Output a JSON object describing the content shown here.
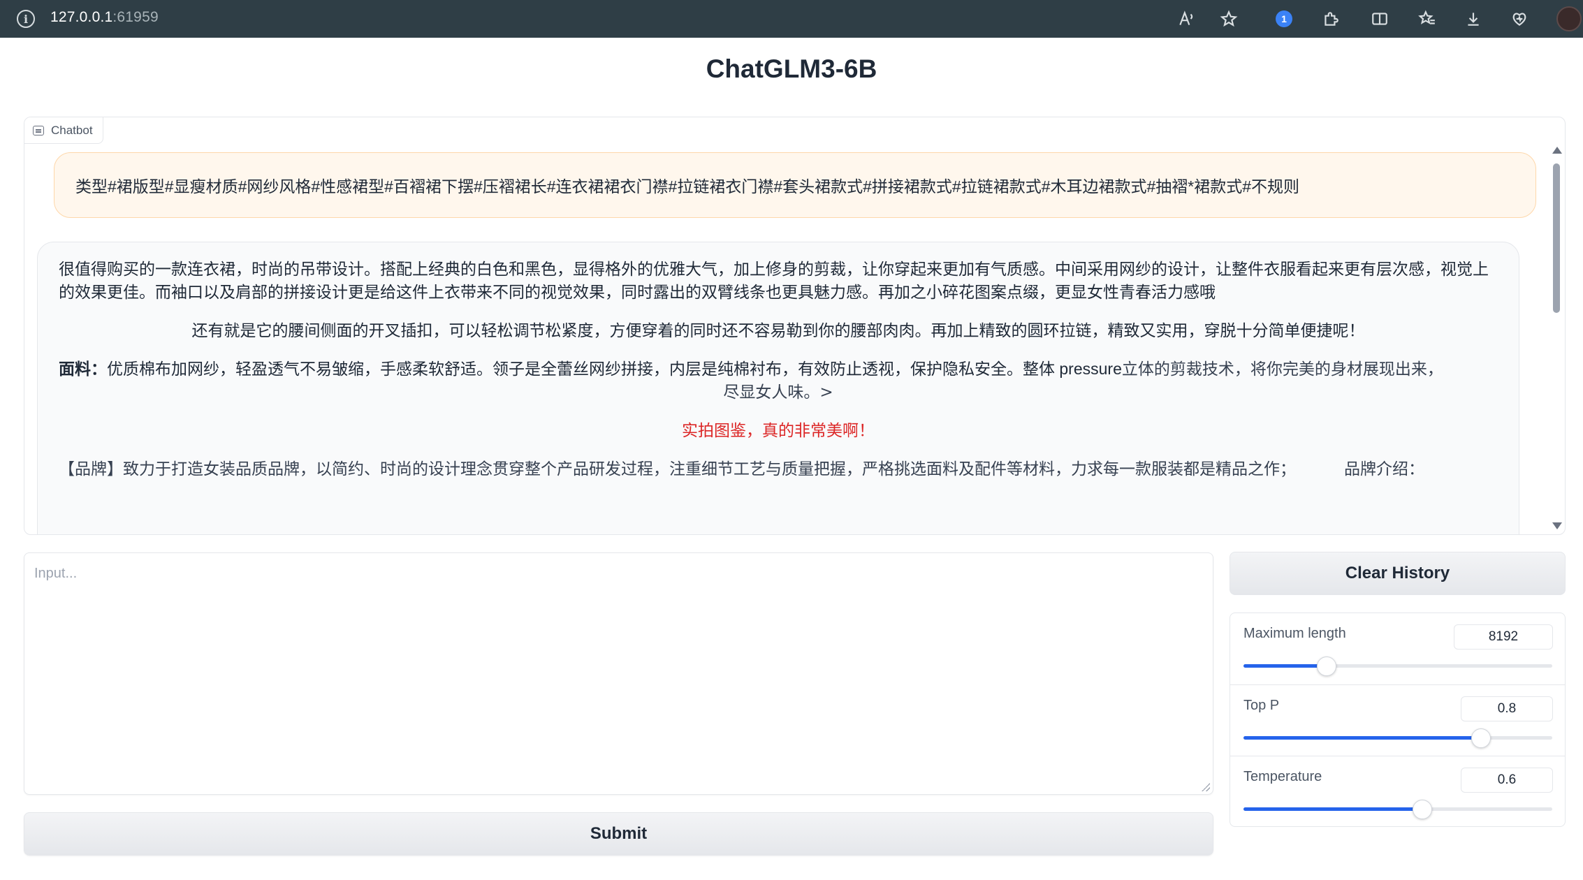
{
  "browser": {
    "url_host": "127.0.0.1",
    "url_port": ":61959"
  },
  "page": {
    "title": "ChatGLM3-6B"
  },
  "chatbot": {
    "label": "Chatbot",
    "user_message": "类型#裙版型#显瘦材质#网纱风格#性感裙型#百褶裙下摆#压褶裙长#连衣裙裙衣门襟#拉链裙衣门襟#套头裙款式#拼接裙款式#拉链裙款式#木耳边裙款式#抽褶*裙款式#不规则",
    "bot_paragraph_1": "很值得购买的一款连衣裙，时尚的吊带设计。搭配上经典的白色和黑色，显得格外的优雅大气，加上修身的剪裁，让你穿起来更加有气质感。中间采用网纱的设计，让整件衣服看起来更有层次感，视觉上的效果更佳。而袖口以及肩部的拼接设计更是给这件上衣带来不同的视觉效果，同时露出的双臂线条也更具魅力感。再加之小碎花图案点缀，更显女性青春活力感哦",
    "bot_paragraph_2": "还有就是它的腰间侧面的开叉插扣，可以轻松调节松紧度，方便穿着的同时还不容易勒到你的腰部肉肉。再加上精致的圆环拉链，精致又实用，穿脱十分简单便捷呢！",
    "bot_paragraph_3_bold": "面料：",
    "bot_paragraph_3_text": "优质棉布加网纱，轻盈透气不易皱缩，手感柔软舒适。领子是全蕾丝网纱拼接，内层是纯棉衬布，有效防止透视，保护隐私安全。整体 pressure",
    "bot_paragraph_3_serif": "立体的剪裁技术，将你完美的身材展现出来，",
    "bot_paragraph_3_line2": "尽显女人味。>",
    "bot_paragraph_4": "实拍图鉴，真的非常美啊！",
    "bot_paragraph_5": "【品牌】致力于打造女装品质品牌，以简约、时尚的设计理念贯穿整个产品研发过程，注重细节工艺与质量把握，严格挑选面料及配件等材料，力求每一款服装都是精品之作；",
    "bot_paragraph_5_side": "品牌介绍："
  },
  "input": {
    "placeholder": "Input...",
    "value": ""
  },
  "buttons": {
    "submit": "Submit",
    "clear_history": "Clear History"
  },
  "params": {
    "max_length": {
      "label": "Maximum length",
      "value": "8192",
      "fraction": 0.27
    },
    "top_p": {
      "label": "Top P",
      "value": "0.8",
      "fraction": 0.77
    },
    "temperature": {
      "label": "Temperature",
      "value": "0.6",
      "fraction": 0.58
    }
  },
  "colors": {
    "accent": "#2563eb",
    "user_bubble": "#fff7ed",
    "browser_bar": "#2f3e46"
  }
}
